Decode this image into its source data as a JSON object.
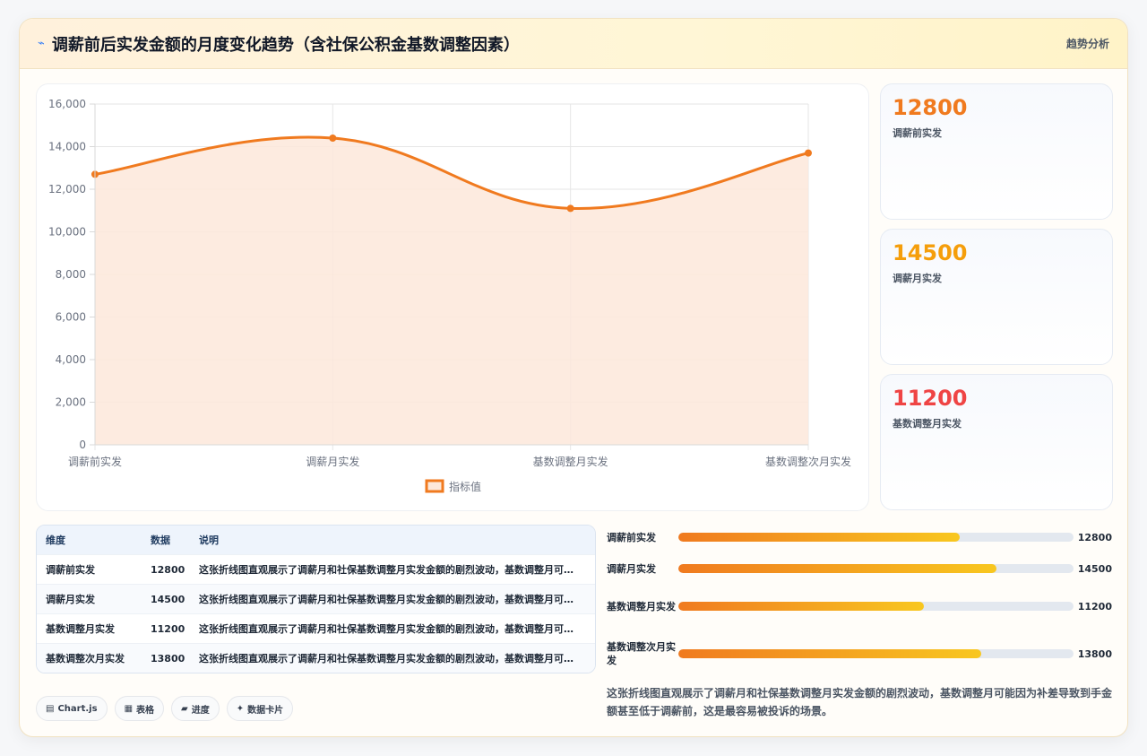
{
  "header": {
    "icon": "⌁",
    "title": "调薪前后实发金额的月度变化趋势（含社保公积金基数调整因素）",
    "tag": "趋势分析"
  },
  "chart_data": {
    "type": "line",
    "categories": [
      "调薪前实发",
      "调薪月实发",
      "基数调整月实发",
      "基数调整次月实发"
    ],
    "series": [
      {
        "name": "指标值",
        "values": [
          12700,
          14400,
          11100,
          13700
        ]
      }
    ],
    "ylim": [
      0,
      16000
    ],
    "yticks": [
      0,
      2000,
      4000,
      6000,
      8000,
      10000,
      12000,
      14000,
      16000
    ],
    "ytick_labels": [
      "0",
      "2,000",
      "4,000",
      "6,000",
      "8,000",
      "10,000",
      "12,000",
      "14,000",
      "16,000"
    ],
    "legend_position": "bottom-center",
    "grid": true,
    "smooth": true,
    "colors": {
      "line": "#f07a1f",
      "fill": "#fde8da"
    }
  },
  "stats": [
    {
      "value": "12800",
      "label": "调薪前实发",
      "color": "#f07a1f"
    },
    {
      "value": "14500",
      "label": "调薪月实发",
      "color": "#f59e0b"
    },
    {
      "value": "11200",
      "label": "基数调整月实发",
      "color": "#ef4444"
    }
  ],
  "table": {
    "headers": [
      "维度",
      "数据",
      "说明"
    ],
    "rows": [
      {
        "dim": "调薪前实发",
        "value": "12800",
        "note": "这张折线图直观展示了调薪月和社保基数调整月实发金额的剧烈波动，基数调整月可能因为补差导致到手金额甚至低于调薪前，这是最容易被投诉的场景。"
      },
      {
        "dim": "调薪月实发",
        "value": "14500",
        "note": "这张折线图直观展示了调薪月和社保基数调整月实发金额的剧烈波动，基数调整月可能因为补差导致到手金额甚至低于调薪前，这是最容易被投诉的场景。"
      },
      {
        "dim": "基数调整月实发",
        "value": "11200",
        "note": "这张折线图直观展示了调薪月和社保基数调整月实发金额的剧烈波动，基数调整月可能因为补差导致到手金额甚至低于调薪前，这是最容易被投诉的场景。"
      },
      {
        "dim": "基数调整次月实发",
        "value": "13800",
        "note": "这张折线图直观展示了调薪月和社保基数调整月实发金额的剧烈波动，基数调整月可能因为补差导致到手金额甚至低于调薪前，这是最容易被投诉的场景。"
      }
    ]
  },
  "chips": [
    {
      "icon": "▤",
      "label": "Chart.js"
    },
    {
      "icon": "▦",
      "label": "表格"
    },
    {
      "icon": "▰",
      "label": "进度"
    },
    {
      "icon": "✦",
      "label": "数据卡片"
    }
  ],
  "progress": {
    "max": 18000,
    "items": [
      {
        "label": "调薪前实发",
        "value": 12800
      },
      {
        "label": "调薪月实发",
        "value": 14500
      },
      {
        "label": "基数调整月实发",
        "value": 11200
      },
      {
        "label": "基数调整次月实发",
        "value": 13800
      }
    ]
  },
  "description": "这张折线图直观展示了调薪月和社保基数调整月实发金额的剧烈波动，基数调整月可能因为补差导致到手金额甚至低于调薪前，这是最容易被投诉的场景。"
}
